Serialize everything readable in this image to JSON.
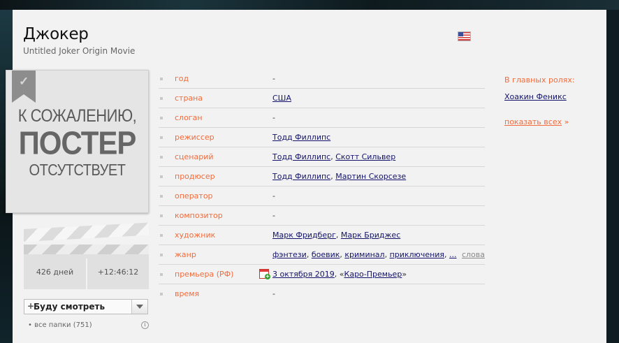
{
  "film": {
    "title": "Джокер",
    "original_title": "Untitled Joker Origin Movie"
  },
  "poster": {
    "line1": "К СОЖАЛЕНИЮ,",
    "line2": "ПОСТЕР",
    "line3": "ОТСУТСТВУЕТ"
  },
  "countdown": {
    "days": "426 дней",
    "time": "+12:46:12"
  },
  "watchlist": {
    "button_label": "Буду смотреть",
    "folders_label": "• все папки (751)"
  },
  "info": {
    "rows": [
      {
        "key": "год",
        "value": "-"
      },
      {
        "key": "страна",
        "value": "США"
      },
      {
        "key": "слоган",
        "value": "-"
      },
      {
        "key": "режиссер",
        "value": "Тодд Филлипс"
      },
      {
        "key": "сценарий",
        "value": "Тодд Филлипс",
        "value2": "Скотт Сильвер"
      },
      {
        "key": "продюсер",
        "value": "Тодд Филлипс",
        "value2": "Мартин Скорсезе"
      },
      {
        "key": "оператор",
        "value": "-"
      },
      {
        "key": "композитор",
        "value": "-"
      },
      {
        "key": "художник",
        "value": "Марк Фридберг",
        "value2": "Марк Бриджес"
      },
      {
        "key": "жанр",
        "genres": [
          "фэнтези",
          "боевик",
          "криминал",
          "приключения",
          "..."
        ],
        "more": "слова"
      },
      {
        "key": "премьера (РФ)",
        "date": "3 октября 2019",
        "distributor": "Каро-Премьер"
      },
      {
        "key": "время",
        "value": "-"
      }
    ]
  },
  "roles": {
    "header": "В главных ролях:",
    "actors": [
      "Хоакин Феникс"
    ],
    "show_all": "показать всех",
    "show_all_arrow": "»"
  },
  "colors": {
    "accent": "#f26b3a",
    "link": "#13136b",
    "panel": "#f2f2f2"
  }
}
